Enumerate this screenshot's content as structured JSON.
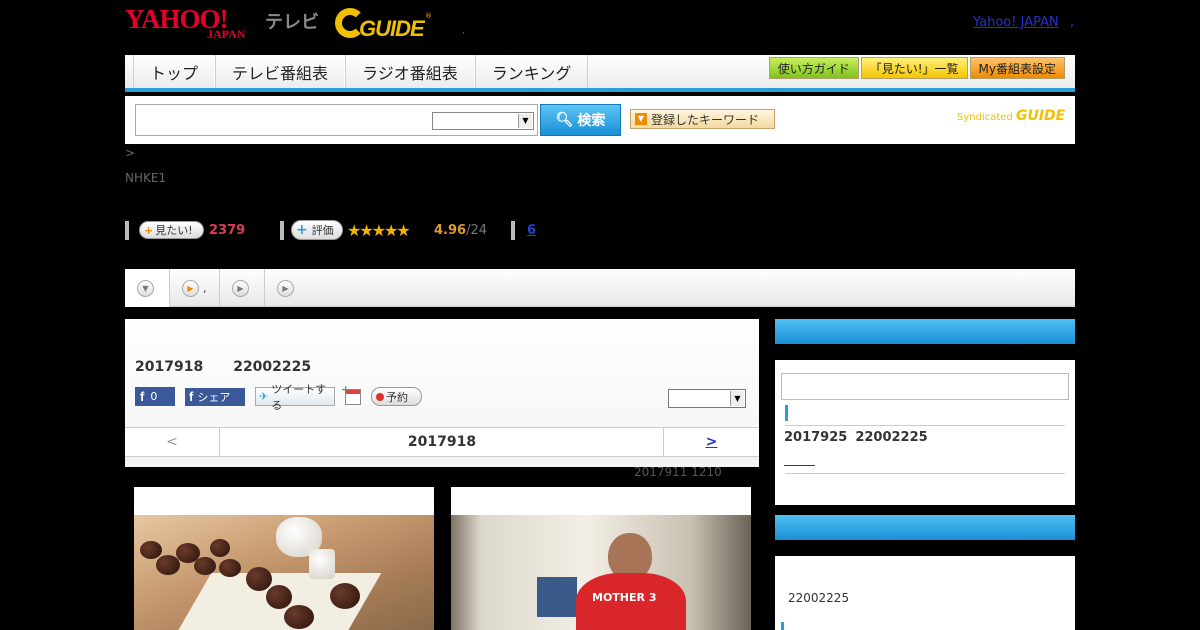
{
  "header": {
    "yahoo_logo": "YAHOO!",
    "yahoo_logo_sub": "JAPAN",
    "tv_label": "テレビ",
    "gguide_logo": "GUIDE",
    "gguide_reg": "®",
    "tiny_mark": ",",
    "yahoo_japan_link": "Yahoo! JAPAN",
    "yahoo_japan_sep": ","
  },
  "nav": {
    "tabs": [
      {
        "label": "トップ"
      },
      {
        "label": "テレビ番組表"
      },
      {
        "label": "ラジオ番組表"
      },
      {
        "label": "ランキング"
      }
    ],
    "right_buttons": [
      {
        "label": "使い方ガイド",
        "color": "#7fc21e"
      },
      {
        "label": "「見たい!」一覧",
        "color": "#f5c400"
      },
      {
        "label": "My番組表設定",
        "color": "#f08a00"
      }
    ]
  },
  "search": {
    "input_value": "",
    "select_value": "",
    "button_label": "検索",
    "keyword_button_label": "登録したキーワード",
    "syndicated_label": "Syndicated",
    "syndicated_logo": "GUIDE"
  },
  "breadcrumb": " >",
  "channel": "NHKE1",
  "stats": {
    "mitai_label": "見たい!",
    "mitai_count": "2379",
    "hyoka_label": "評価",
    "stars": "★★★★★",
    "score": "4.96",
    "score_of": "/24",
    "count_link": "6"
  },
  "subtabs": [
    {
      "label": ""
    },
    {
      "label": ","
    },
    {
      "label": ""
    },
    {
      "label": ""
    }
  ],
  "main": {
    "date": "2017918",
    "time": "22002225",
    "fb_count": "0",
    "fb_share_label": "シェア",
    "tweet_label": "ツイートする",
    "reserve_label": "予約",
    "select_value": "",
    "day_prev": "<",
    "day_current": "2017918",
    "day_next": ">",
    "updated": "2017911  1210"
  },
  "cards": [
    {
      "image": "sweets-tea-photo"
    },
    {
      "image": "man-red-shirt-photo",
      "shirt_text": "MOTHER 3"
    }
  ],
  "sidebar": {
    "box1": {
      "input_value": "",
      "row_date": "2017925",
      "row_time": "22002225"
    },
    "box2": {
      "time": "22002225"
    }
  },
  "colors": {
    "accent_blue": "#2a9fd6",
    "yahoo_red": "#e4002b",
    "gguide_yellow": "#f0c000",
    "link_blue": "#2233cc"
  }
}
